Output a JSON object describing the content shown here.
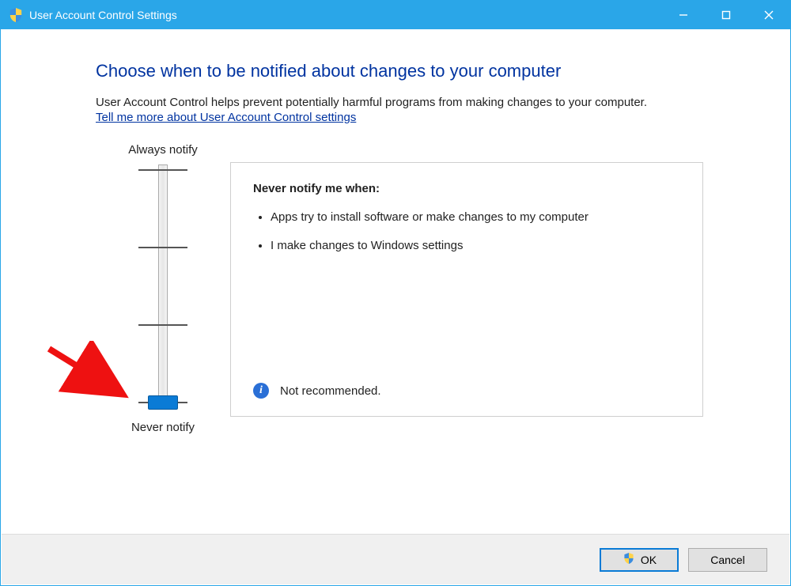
{
  "window": {
    "title": "User Account Control Settings"
  },
  "main": {
    "heading": "Choose when to be notified about changes to your computer",
    "intro": "User Account Control helps prevent potentially harmful programs from making changes to your computer.",
    "learn_link": "Tell me more about User Account Control settings"
  },
  "slider": {
    "label_top": "Always notify",
    "label_bottom": "Never notify",
    "levels": 4,
    "current_level": 0
  },
  "panel": {
    "title": "Never notify me when:",
    "bullets": [
      "Apps try to install software or make changes to my computer",
      "I make changes to Windows settings"
    ],
    "footer_text": "Not recommended."
  },
  "bottom": {
    "ok_label": "OK",
    "cancel_label": "Cancel"
  }
}
